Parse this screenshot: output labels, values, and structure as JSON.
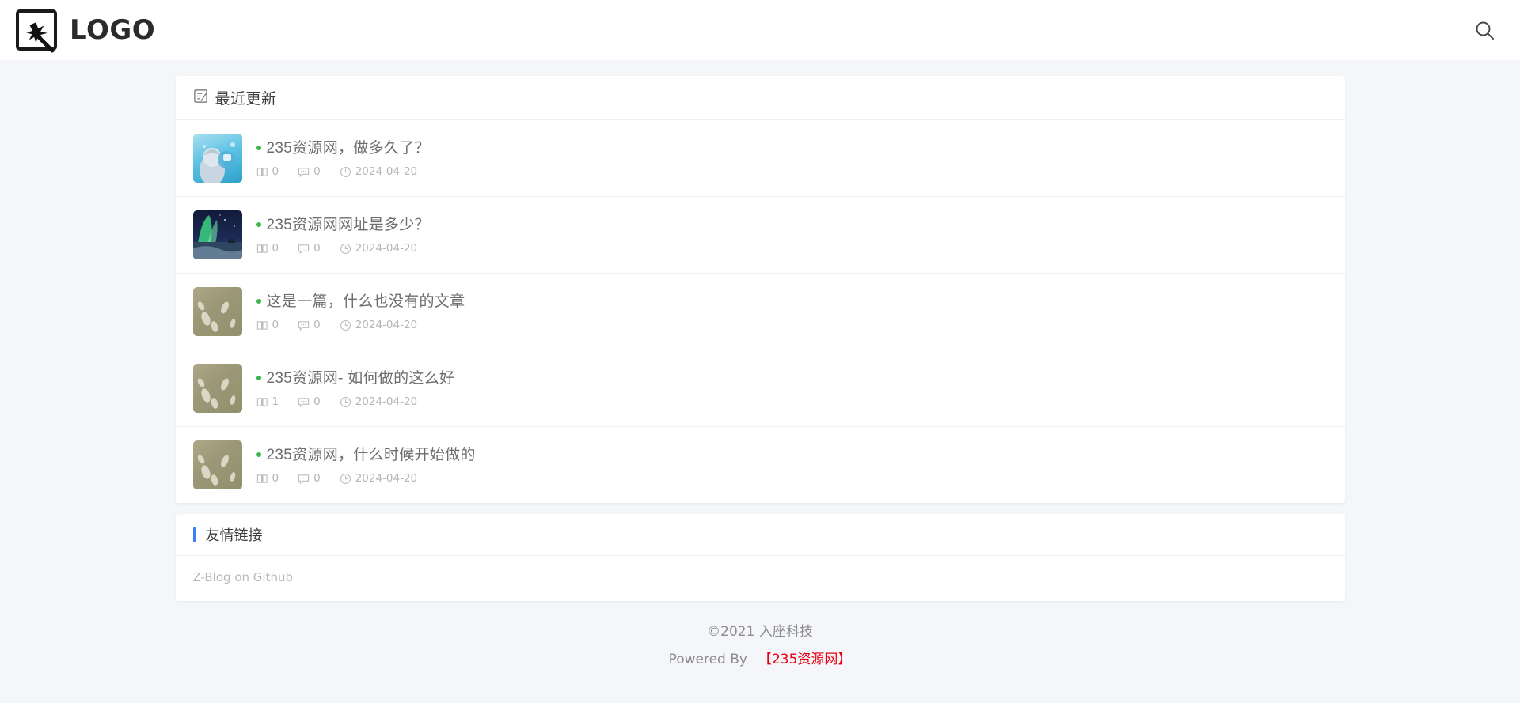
{
  "header": {
    "logo_text": "LOGO",
    "logo_icon": "image-star-logo-icon",
    "search_icon": "search-icon"
  },
  "recent": {
    "icon": "note-edit-icon",
    "title": "最近更新",
    "posts": [
      {
        "title": "235资源网，做多久了？",
        "views": "0",
        "comments": "0",
        "date": "2024-04-20",
        "thumb": "anime-character-teal"
      },
      {
        "title": "235资源网网址是多少？",
        "views": "0",
        "comments": "0",
        "date": "2024-04-20",
        "thumb": "aurora-night-landscape"
      },
      {
        "title": "这是一篇，什么也没有的文章",
        "views": "0",
        "comments": "0",
        "date": "2024-04-20",
        "thumb": "white-blossom-blur"
      },
      {
        "title": "235资源网- 如何做的这么好",
        "views": "1",
        "comments": "0",
        "date": "2024-04-20",
        "thumb": "white-blossom-blur"
      },
      {
        "title": "235资源网，什么时候开始做的",
        "views": "0",
        "comments": "0",
        "date": "2024-04-20",
        "thumb": "white-blossom-blur"
      }
    ]
  },
  "friend_links": {
    "title": "友情链接",
    "accent_color": "#3d7eff",
    "items": [
      {
        "label": "Z-Blog on Github"
      }
    ]
  },
  "footer": {
    "copyright": "©2021  入座科技",
    "powered_label": "Powered By",
    "powered_link": "【235资源网】",
    "powered_link_color": "#e60012"
  }
}
